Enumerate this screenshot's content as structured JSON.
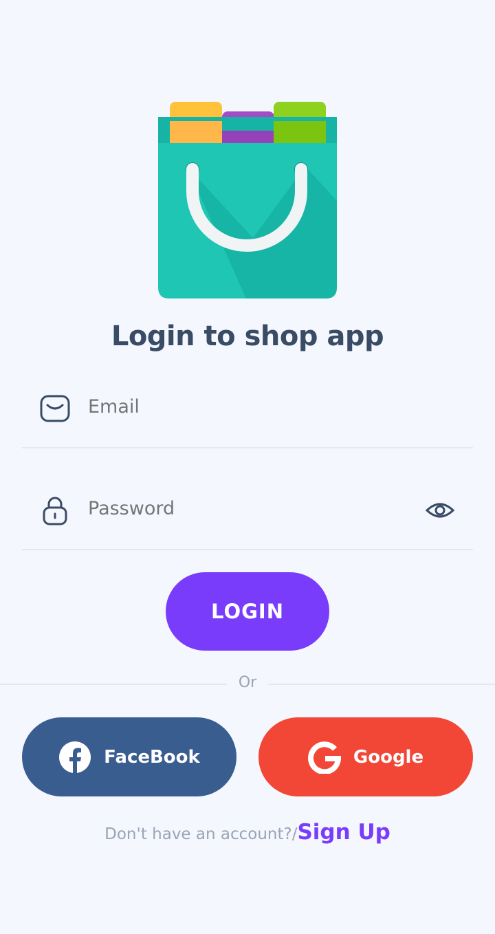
{
  "app": {
    "title": "Login to shop app"
  },
  "form": {
    "email_placeholder": "Email",
    "password_placeholder": "Password",
    "login_label": "LOGIN"
  },
  "divider": {
    "text": "Or"
  },
  "social": {
    "facebook_label": "FaceBook",
    "google_label": "Google"
  },
  "signup": {
    "prompt": "Don't have an account?/",
    "link_label": "Sign Up"
  },
  "icons": {
    "logo": "shopping-bag-icon",
    "email": "mail-icon",
    "password": "lock-icon",
    "toggle": "eye-icon",
    "facebook": "facebook-icon",
    "google": "google-icon"
  },
  "colors": {
    "accent": "#7a3cfb",
    "facebook": "#3a5d8f",
    "google": "#f24636",
    "heading": "#3a4b66",
    "muted": "#9aa4b5",
    "background": "#f4f7fd"
  }
}
